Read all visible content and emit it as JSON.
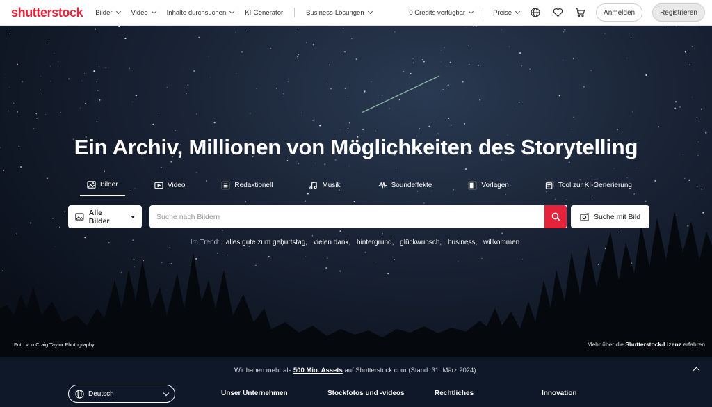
{
  "header": {
    "logo": "shutterstock",
    "nav": [
      {
        "label": "Bilder",
        "has_dropdown": true
      },
      {
        "label": "Video",
        "has_dropdown": true
      },
      {
        "label": "Inhalte durchsuchen",
        "has_dropdown": true
      },
      {
        "label": "KI-Generator",
        "has_dropdown": false
      },
      {
        "label": "Business-Lösungen",
        "has_dropdown": true
      }
    ],
    "credits": "0 Credits verfügbar",
    "pricing": "Preise",
    "login": "Anmelden",
    "register": "Registrieren",
    "icons": [
      "globe-icon",
      "heart-icon",
      "cart-icon"
    ]
  },
  "hero": {
    "headline": "Ein Archiv, Millionen von Möglichkeiten des Storytelling",
    "tabs": [
      {
        "label": "Bilder",
        "icon": "image-icon",
        "active": true
      },
      {
        "label": "Video",
        "icon": "video-icon",
        "active": false
      },
      {
        "label": "Redaktionell",
        "icon": "editorial-icon",
        "active": false
      },
      {
        "label": "Musik",
        "icon": "music-icon",
        "active": false
      },
      {
        "label": "Soundeffekte",
        "icon": "soundwave-icon",
        "active": false
      },
      {
        "label": "Vorlagen",
        "icon": "template-icon",
        "active": false
      },
      {
        "label": "Tool zur KI-Generierung",
        "icon": "ai-icon",
        "active": false
      }
    ],
    "filter": "Alle Bilder",
    "search_placeholder": "Suche nach Bildern",
    "image_search": "Suche mit Bild",
    "trending_label": "Im Trend:",
    "trending": [
      "alles gute zum geburtstag,",
      "vielen dank,",
      "hintergrund,",
      "glückwunsch,",
      "business,",
      "willkommen"
    ],
    "credit_prefix": "Foto von",
    "credit_author": "Craig Taylor Photography",
    "license_prefix": "Mehr über die",
    "license_link": "Shutterstock-Lizenz",
    "license_suffix": "erfahren"
  },
  "footer": {
    "note_prefix": "Wir haben mehr als",
    "note_link": "500 Mio. Assets",
    "note_suffix": "auf Shutterstock.com (Stand: 31. März 2024).",
    "language": "Deutsch",
    "columns": [
      "Unser Unternehmen",
      "Stockfotos und -videos",
      "Rechtliches",
      "Innovation"
    ]
  },
  "colors": {
    "brand": "#e5243b",
    "footer_bg": "#0f1828"
  }
}
